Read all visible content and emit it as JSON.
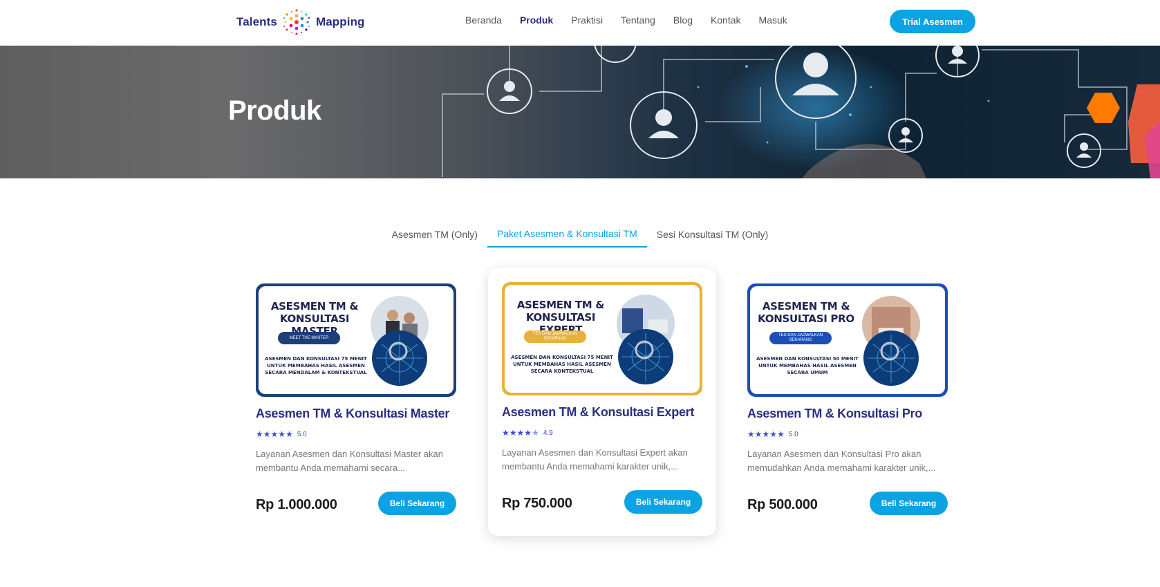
{
  "nav": {
    "logo_left": "Talents",
    "logo_right": "Mapping",
    "items": [
      {
        "label": "Beranda",
        "active": false
      },
      {
        "label": "Produk",
        "active": true
      },
      {
        "label": "Praktisi",
        "active": false
      },
      {
        "label": "Tentang",
        "active": false
      },
      {
        "label": "Blog",
        "active": false
      },
      {
        "label": "Kontak",
        "active": false
      },
      {
        "label": "Masuk",
        "active": false
      }
    ],
    "cta": "Trial Asesmen"
  },
  "hero": {
    "title": "Produk"
  },
  "tabs": [
    {
      "label": "Asesmen TM (Only)",
      "active": false
    },
    {
      "label": "Paket Asesmen & Konsultasi TM",
      "active": true
    },
    {
      "label": "Sesi Konsultasi TM (Only)",
      "active": false
    }
  ],
  "products": [
    {
      "image_title": "ASESMEN TM & KONSULTASI MASTER",
      "image_pill": "MEET THE MASTER",
      "image_desc": "ASESMEN DAN KONSULTASI 75 MENIT UNTUK MEMBAHAS HASIL ASESMEN SECARA MENDALAM & KONTEKSTUAL",
      "title": "Asesmen TM & Konsultasi Master",
      "rating": "5.0",
      "stars": 5,
      "description": "Layanan Asesmen dan Konsultasi Master akan membantu Anda memahami secara...",
      "price": "Rp 1.000.000",
      "button": "Beli Sekarang",
      "accent": "#1c3f7a",
      "pill_color": "#1c3f7a"
    },
    {
      "image_title": "ASESMEN TM & KONSULTASI EXPERT",
      "image_pill": "TES DAN JADWALKAN SEKARANG",
      "image_desc": "ASESMEN DAN KONSULTASI 75 MENIT UNTUK MEMBAHAS HASIL ASESMEN SECARA KONTEKSTUAL",
      "title": "Asesmen TM & Konsultasi Expert",
      "rating": "4.9",
      "stars": 4.5,
      "description": "Layanan Asesmen dan Konsultasi Expert akan membantu Anda memahami karakter unik,...",
      "price": "Rp 750.000",
      "button": "Beli Sekarang",
      "accent": "#e7b23b",
      "pill_color": "#e7b23b"
    },
    {
      "image_title": "ASESMEN TM & KONSULTASI PRO",
      "image_pill": "TES DAN JADWALKAN SEKARANG",
      "image_desc": "ASESMEN DAN KONSULTASI 50 MENIT UNTUK MEMBAHAS HASIL ASESMEN SECARA UMUM",
      "title": "Asesmen TM & Konsultasi Pro",
      "rating": "5.0",
      "stars": 5,
      "description": "Layanan Asesmen dan Konsultasi Pro akan memudahkan Anda memahami karakter unik,...",
      "price": "Rp 500.000",
      "button": "Beli Sekarang",
      "accent": "#1a4fb8",
      "pill_color": "#1a4fb8"
    }
  ],
  "colors": {
    "brand_navy": "#2b2e83",
    "primary_blue": "#0ba3e3",
    "star_blue": "#3b4bdc"
  }
}
